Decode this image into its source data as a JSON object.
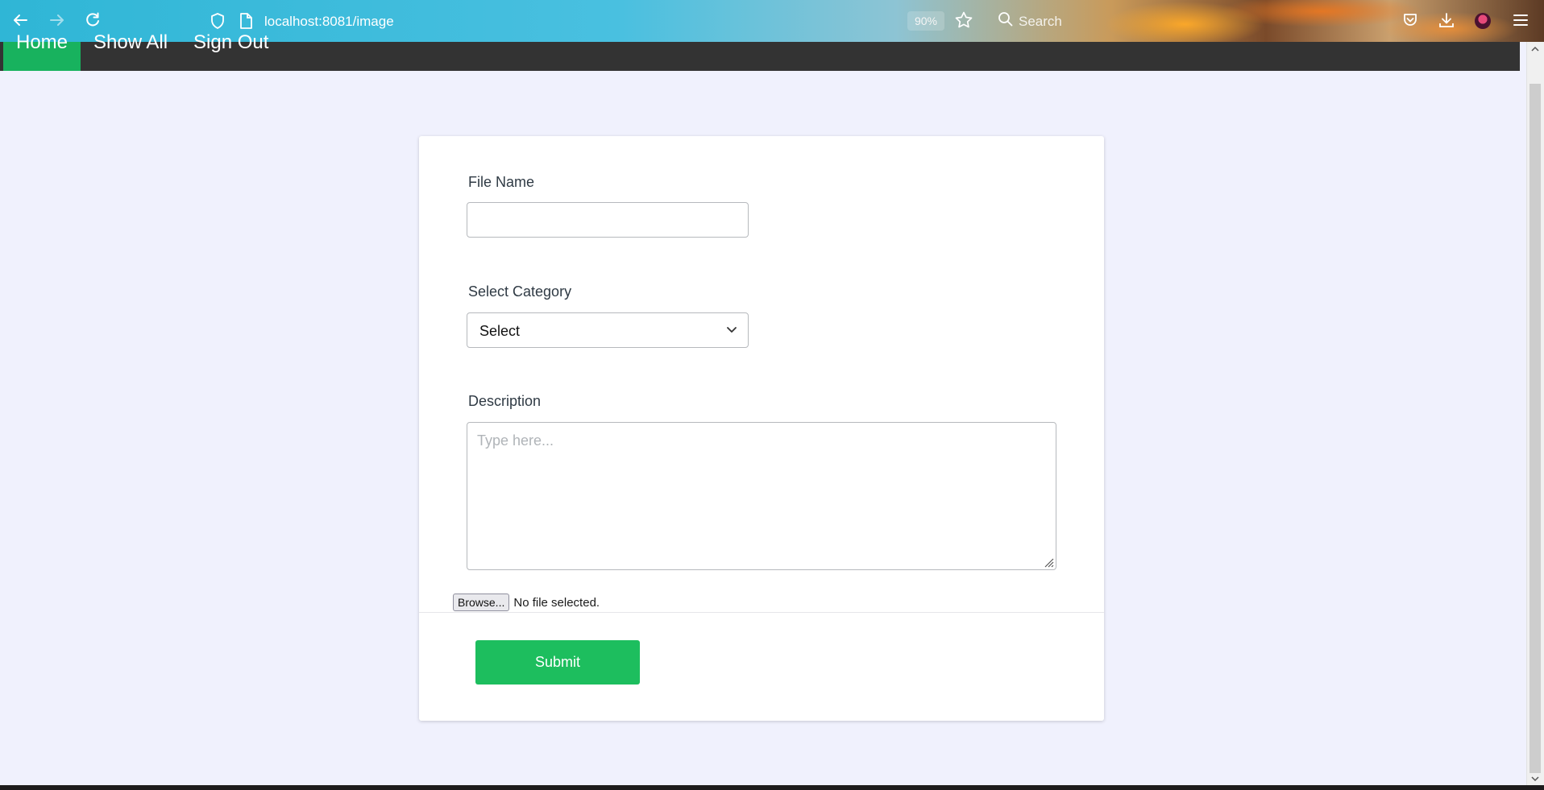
{
  "browser": {
    "url": "localhost:8081/image",
    "zoom": "90%",
    "search_placeholder": "Search"
  },
  "nav": {
    "items": [
      {
        "label": "Home",
        "active": true
      },
      {
        "label": "Show All",
        "active": false
      },
      {
        "label": "Sign Out",
        "active": false
      }
    ],
    "active_color": "#18b25e",
    "bg_color": "#333333"
  },
  "form": {
    "file_name_label": "File Name",
    "file_name_value": "",
    "category_label": "Select Category",
    "category_selected": "Select",
    "description_label": "Description",
    "description_placeholder": "Type here...",
    "browse_label": "Browse...",
    "file_status": "No file selected.",
    "submit_label": "Submit",
    "submit_color": "#1dbe5e"
  }
}
